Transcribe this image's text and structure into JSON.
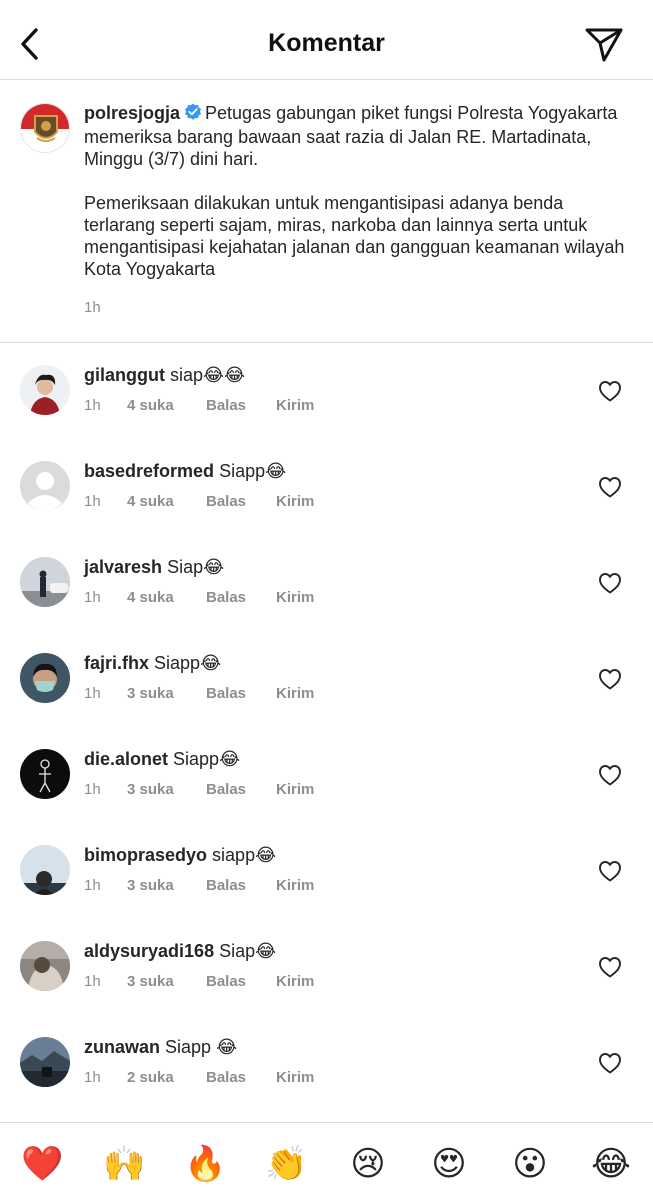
{
  "header": {
    "title": "Komentar"
  },
  "caption": {
    "username": "polresjogja",
    "paragraph1": "Petugas gabungan piket fungsi Polresta Yogyakarta memeriksa barang bawaan saat razia di Jalan RE. Martadinata, Minggu (3/7) dini hari.",
    "paragraph2": "Pemeriksaan dilakukan untuk mengantisipasi adanya benda terlarang seperti sajam, miras, narkoba dan lainnya serta untuk mengantisipasi kejahatan jalanan dan gangguan keamanan wilayah Kota Yogyakarta",
    "time": "1h"
  },
  "comments": [
    {
      "username": "gilanggut",
      "text": "siap😂😂",
      "time": "1h",
      "likes": "4 suka",
      "reply": "Balas",
      "send": "Kirim"
    },
    {
      "username": "basedreformed",
      "text": "Siapp😂",
      "time": "1h",
      "likes": "4 suka",
      "reply": "Balas",
      "send": "Kirim"
    },
    {
      "username": "jalvaresh",
      "text": "Siap😂",
      "time": "1h",
      "likes": "4 suka",
      "reply": "Balas",
      "send": "Kirim"
    },
    {
      "username": "fajri.fhx",
      "text": "Siapp😂",
      "time": "1h",
      "likes": "3 suka",
      "reply": "Balas",
      "send": "Kirim"
    },
    {
      "username": "die.alonet",
      "text": "Siapp😂",
      "time": "1h",
      "likes": "3 suka",
      "reply": "Balas",
      "send": "Kirim"
    },
    {
      "username": "bimoprasedyo",
      "text": "siapp😂",
      "time": "1h",
      "likes": "3 suka",
      "reply": "Balas",
      "send": "Kirim"
    },
    {
      "username": "aldysuryadi168",
      "text": "Siap😂",
      "time": "1h",
      "likes": "3 suka",
      "reply": "Balas",
      "send": "Kirim"
    },
    {
      "username": "zunawan",
      "text": "Siapp 😂",
      "time": "1h",
      "likes": "2 suka",
      "reply": "Balas",
      "send": "Kirim"
    }
  ],
  "emoji_bar": [
    "❤️",
    "🙌",
    "🔥",
    "👏",
    "😢",
    "😍",
    "😮",
    "😂"
  ],
  "colors": {
    "verified": "#3897f0",
    "muted": "#8e8e8e",
    "divider": "#dbdbdb"
  }
}
